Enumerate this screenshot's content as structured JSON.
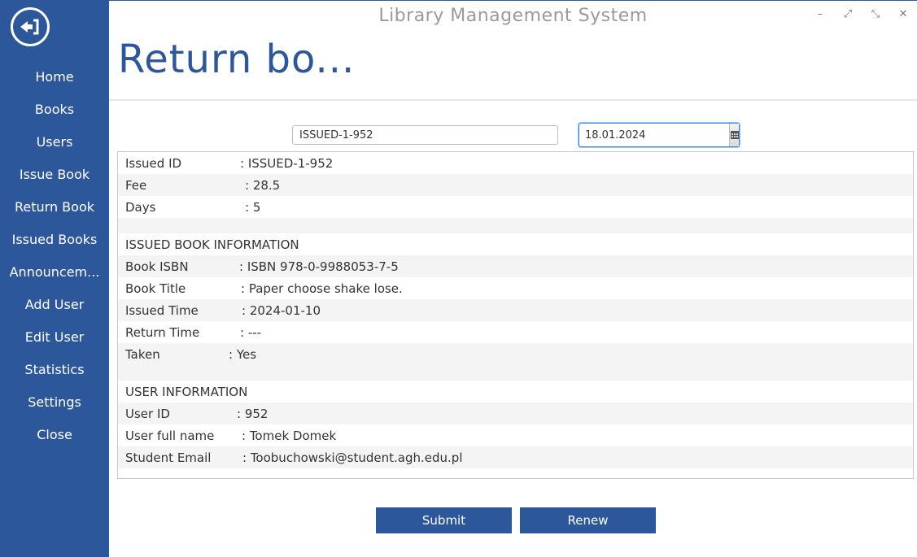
{
  "app_title": "Library Management System",
  "page_title": "Return bo...",
  "sidebar": {
    "back_icon": "back-arrow-icon",
    "items": [
      {
        "label": "Home"
      },
      {
        "label": "Books"
      },
      {
        "label": "Users"
      },
      {
        "label": "Issue Book"
      },
      {
        "label": "Return Book"
      },
      {
        "label": "Issued Books"
      },
      {
        "label": "Announcem..."
      },
      {
        "label": "Add User"
      },
      {
        "label": "Edit User"
      },
      {
        "label": "Statistics"
      },
      {
        "label": "Settings"
      },
      {
        "label": "Close"
      }
    ]
  },
  "window_controls": {
    "minimize": "–",
    "maximize": "⤢",
    "restore": "⤡",
    "close": "✕"
  },
  "form": {
    "issued_id_value": "ISSUED-1-952",
    "date_value": "18.01.2024",
    "calendar_icon": "calendar-icon"
  },
  "details": {
    "rows": [
      {
        "label": "Issued ID",
        "value": ": ISSUED-1-952"
      },
      {
        "label": "Fee",
        "value": ": 28.5"
      },
      {
        "label": "Days",
        "value": ": 5"
      }
    ],
    "book_section_title": "ISSUED BOOK INFORMATION",
    "book_rows": [
      {
        "label": "Book ISBN",
        "value": ": ISBN 978-0-9988053-7-5"
      },
      {
        "label": "Book Title",
        "value": ": Paper choose shake lose."
      },
      {
        "label": "Issued Time",
        "value": ": 2024-01-10"
      },
      {
        "label": "Return Time",
        "value": ": ---"
      },
      {
        "label": "Taken",
        "value": ": Yes"
      }
    ],
    "user_section_title": "USER INFORMATION",
    "user_rows": [
      {
        "label": "User ID",
        "value": ": 952"
      },
      {
        "label": "User full name",
        "value": ": Tomek Domek"
      },
      {
        "label": "Student Email",
        "value": ": Toobuchowski@student.agh.edu.pl"
      }
    ]
  },
  "buttons": {
    "submit": "Submit",
    "renew": "Renew"
  },
  "colors": {
    "brand": "#2d579b",
    "accent_focus": "#3c8bd6"
  }
}
